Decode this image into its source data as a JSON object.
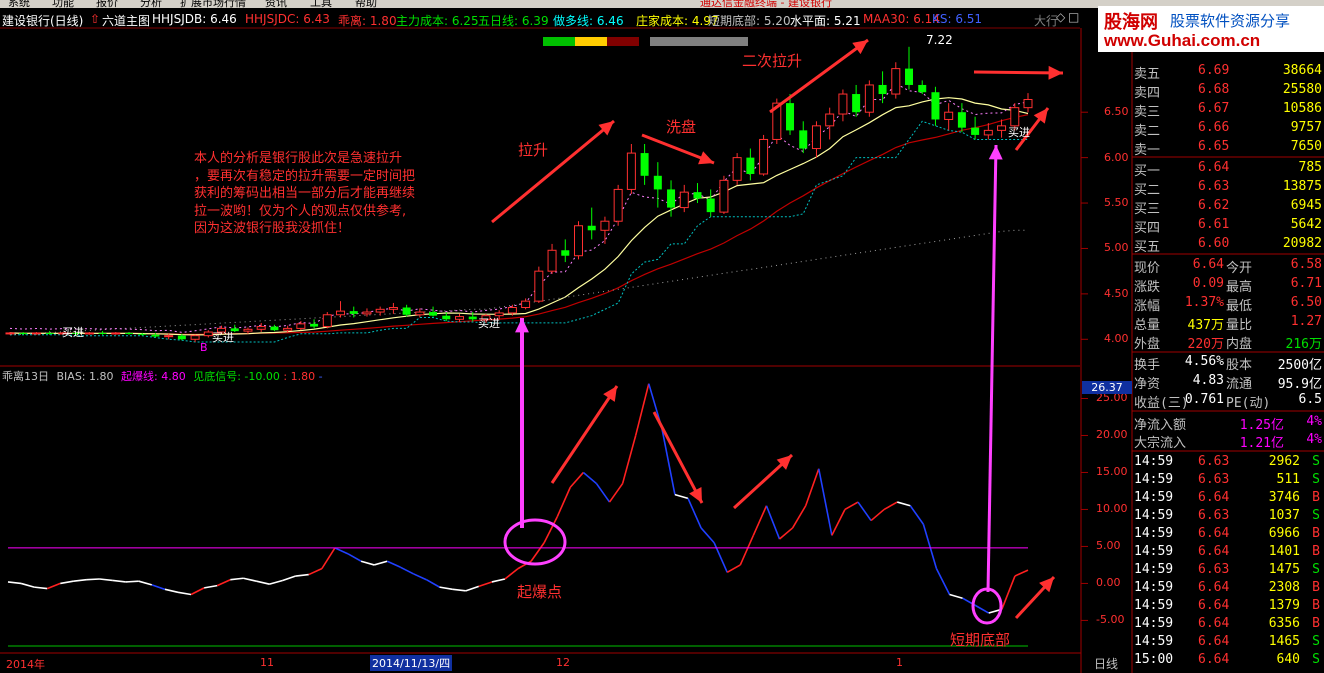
{
  "menu": [
    "系统",
    "功能",
    "报价",
    "分析",
    "扩展市场行情",
    "资讯",
    "工具",
    "帮助"
  ],
  "menu_notice": "通达信金融终端 - 建设银行",
  "header": {
    "stock": "建设银行(日线)",
    "indicator_set": "六道主图",
    "items": [
      {
        "label": "HHJSJDB: 6.46",
        "color": "#ffffff"
      },
      {
        "label": "HHJSJDC: 6.43",
        "color": "#ff3030"
      },
      {
        "label": "乖离: 1.80",
        "color": "#ff3030"
      },
      {
        "label": "主力成本: 6.25",
        "color": "#00e000"
      },
      {
        "label": "五日线: 6.39",
        "color": "#00e000"
      },
      {
        "label": "做多线: 6.46",
        "color": "#00ffff"
      },
      {
        "label": "庄家成本: 4.97",
        "color": "#ffff00"
      },
      {
        "label": "短期底部: 5.20",
        "color": "#c0c0c0"
      },
      {
        "label": "水平面: 5.21",
        "color": "#ffffff"
      },
      {
        "label": "MAA30: 6.14",
        "color": "#ff3030"
      },
      {
        "label": "KS: 6.51",
        "color": "#4060ff"
      }
    ],
    "right_label": "大行",
    "high_label": "7.22"
  },
  "watermark": {
    "brand": "股海网",
    "slogan": "股票软件资源分享",
    "url": "www.Guhai.com.cn"
  },
  "price_axis": [
    "6.50",
    "6.00",
    "5.50",
    "5.00",
    "4.50",
    "4.00"
  ],
  "bias_axis": [
    "25.00",
    "20.00",
    "15.00",
    "10.00",
    "5.00",
    "0.00",
    "-5.00"
  ],
  "bias_current": "26.37",
  "sub_header": {
    "name": "乖离13日",
    "bias": "BIAS: 1.80",
    "burst": "起爆线: 4.80",
    "bottom_signal": "见底信号: -10.00",
    "last": ": 1.80"
  },
  "date_axis": [
    "2014年",
    "11",
    "2014/11/13/四",
    "12",
    "1"
  ],
  "period": "日线",
  "annotations": {
    "analysis": [
      "本人的分析是银行股此次是急速拉升",
      "，要再次有稳定的拉升需要一定时间把",
      "获利的筹码出相当一部分后才能再继续",
      "拉一波哟！仅为个人的观点仅供参考,",
      "因为这波银行股我没抓住！"
    ],
    "pull_up": "拉升",
    "wash": "洗盘",
    "second_pull": "二次拉升",
    "burst_point": "起爆点",
    "short_bottom": "短期底部",
    "buy_marks": [
      "买进",
      "买进",
      "买进",
      "买进"
    ],
    "b_mark": "B"
  },
  "order_book": {
    "asks": [
      {
        "label": "卖五",
        "price": "6.69",
        "vol": "38664"
      },
      {
        "label": "卖四",
        "price": "6.68",
        "vol": "25580"
      },
      {
        "label": "卖三",
        "price": "6.67",
        "vol": "10586"
      },
      {
        "label": "卖二",
        "price": "6.66",
        "vol": "9757"
      },
      {
        "label": "卖一",
        "price": "6.65",
        "vol": "7650"
      }
    ],
    "bids": [
      {
        "label": "买一",
        "price": "6.64",
        "vol": "785"
      },
      {
        "label": "买二",
        "price": "6.63",
        "vol": "13875"
      },
      {
        "label": "买三",
        "price": "6.62",
        "vol": "6945"
      },
      {
        "label": "买四",
        "price": "6.61",
        "vol": "5642"
      },
      {
        "label": "买五",
        "price": "6.60",
        "vol": "20982"
      }
    ]
  },
  "quote": [
    {
      "l1": "现价",
      "v1": "6.64",
      "l2": "今开",
      "v2": "6.58"
    },
    {
      "l1": "涨跌",
      "v1": "0.09",
      "l2": "最高",
      "v2": "6.71"
    },
    {
      "l1": "涨幅",
      "v1": "1.37%",
      "l2": "最低",
      "v2": "6.50"
    },
    {
      "l1": "总量",
      "v1": "437万",
      "l2": "量比",
      "v2": "1.27"
    },
    {
      "l1": "外盘",
      "v1": "220万",
      "l2": "内盘",
      "v2": "216万"
    },
    {
      "l1": "换手",
      "v1": "4.56%",
      "l2": "股本",
      "v2": "2500亿"
    },
    {
      "l1": "净资",
      "v1": "4.83",
      "l2": "流通",
      "v2": "95.9亿"
    },
    {
      "l1": "收益(三)",
      "v1": "0.761",
      "l2": "PE(动)",
      "v2": "6.5"
    }
  ],
  "flows": [
    {
      "label": "净流入额",
      "value": "1.25亿",
      "pct": "4%"
    },
    {
      "label": "大宗流入",
      "value": "1.21亿",
      "pct": "4%"
    }
  ],
  "ticks": [
    {
      "time": "14:59",
      "price": "6.63",
      "vol": "2962",
      "side": "S"
    },
    {
      "time": "14:59",
      "price": "6.63",
      "vol": "511",
      "side": "S"
    },
    {
      "time": "14:59",
      "price": "6.64",
      "vol": "3746",
      "side": "B"
    },
    {
      "time": "14:59",
      "price": "6.63",
      "vol": "1037",
      "side": "S"
    },
    {
      "time": "14:59",
      "price": "6.64",
      "vol": "6966",
      "side": "B"
    },
    {
      "time": "14:59",
      "price": "6.64",
      "vol": "1401",
      "side": "B"
    },
    {
      "time": "14:59",
      "price": "6.63",
      "vol": "1475",
      "side": "S"
    },
    {
      "time": "14:59",
      "price": "6.64",
      "vol": "2308",
      "side": "B"
    },
    {
      "time": "14:59",
      "price": "6.64",
      "vol": "1379",
      "side": "B"
    },
    {
      "time": "14:59",
      "price": "6.64",
      "vol": "6356",
      "side": "B"
    },
    {
      "time": "14:59",
      "price": "6.64",
      "vol": "1465",
      "side": "S"
    },
    {
      "time": "15:00",
      "price": "6.64",
      "vol": "640",
      "side": "S"
    }
  ],
  "chart_data": {
    "type": "candlestick",
    "price_range": [
      3.75,
      7.35
    ],
    "candles": [
      [
        4.07,
        4.08,
        4.05,
        4.07
      ],
      [
        4.07,
        4.08,
        4.05,
        4.06
      ],
      [
        4.06,
        4.08,
        4.05,
        4.07
      ],
      [
        4.07,
        4.09,
        4.05,
        4.06
      ],
      [
        4.06,
        4.08,
        4.05,
        4.07
      ],
      [
        4.07,
        4.08,
        4.04,
        4.06
      ],
      [
        4.06,
        4.08,
        4.05,
        4.07
      ],
      [
        4.07,
        4.09,
        4.05,
        4.06
      ],
      [
        4.06,
        4.08,
        4.05,
        4.07
      ],
      [
        4.07,
        4.08,
        4.05,
        4.06
      ],
      [
        4.06,
        4.07,
        4.04,
        4.05
      ],
      [
        4.05,
        4.07,
        4.02,
        4.03
      ],
      [
        4.03,
        4.06,
        4.0,
        4.04
      ],
      [
        4.04,
        4.06,
        3.99,
        4.0
      ],
      [
        4.0,
        4.05,
        3.97,
        4.04
      ],
      [
        4.04,
        4.1,
        4.02,
        4.08
      ],
      [
        4.08,
        4.15,
        4.06,
        4.12
      ],
      [
        4.12,
        4.16,
        4.08,
        4.09
      ],
      [
        4.09,
        4.13,
        4.06,
        4.11
      ],
      [
        4.11,
        4.18,
        4.08,
        4.14
      ],
      [
        4.14,
        4.16,
        4.09,
        4.1
      ],
      [
        4.1,
        4.15,
        4.07,
        4.12
      ],
      [
        4.12,
        4.2,
        4.1,
        4.17
      ],
      [
        4.17,
        4.22,
        4.12,
        4.14
      ],
      [
        4.14,
        4.3,
        4.12,
        4.27
      ],
      [
        4.27,
        4.42,
        4.24,
        4.31
      ],
      [
        4.31,
        4.36,
        4.24,
        4.28
      ],
      [
        4.28,
        4.34,
        4.25,
        4.3
      ],
      [
        4.3,
        4.36,
        4.26,
        4.33
      ],
      [
        4.33,
        4.4,
        4.28,
        4.35
      ],
      [
        4.35,
        4.38,
        4.25,
        4.27
      ],
      [
        4.27,
        4.34,
        4.24,
        4.3
      ],
      [
        4.3,
        4.36,
        4.25,
        4.26
      ],
      [
        4.26,
        4.3,
        4.2,
        4.22
      ],
      [
        4.22,
        4.28,
        4.19,
        4.25
      ],
      [
        4.25,
        4.3,
        4.2,
        4.22
      ],
      [
        4.22,
        4.28,
        4.18,
        4.26
      ],
      [
        4.26,
        4.32,
        4.22,
        4.29
      ],
      [
        4.29,
        4.38,
        4.26,
        4.35
      ],
      [
        4.35,
        4.45,
        4.33,
        4.42
      ],
      [
        4.42,
        4.8,
        4.4,
        4.75
      ],
      [
        4.75,
        5.05,
        4.72,
        4.98
      ],
      [
        4.98,
        5.1,
        4.85,
        4.92
      ],
      [
        4.92,
        5.3,
        4.88,
        5.25
      ],
      [
        5.25,
        5.45,
        5.1,
        5.2
      ],
      [
        5.2,
        5.35,
        5.05,
        5.3
      ],
      [
        5.3,
        5.7,
        5.25,
        5.65
      ],
      [
        5.65,
        6.15,
        5.6,
        6.05
      ],
      [
        6.05,
        6.15,
        5.7,
        5.8
      ],
      [
        5.8,
        5.95,
        5.45,
        5.65
      ],
      [
        5.65,
        5.75,
        5.35,
        5.45
      ],
      [
        5.45,
        5.7,
        5.4,
        5.62
      ],
      [
        5.62,
        5.72,
        5.5,
        5.55
      ],
      [
        5.55,
        5.65,
        5.35,
        5.4
      ],
      [
        5.4,
        5.8,
        5.38,
        5.75
      ],
      [
        5.75,
        6.05,
        5.7,
        6.0
      ],
      [
        6.0,
        6.1,
        5.75,
        5.82
      ],
      [
        5.82,
        6.25,
        5.8,
        6.2
      ],
      [
        6.2,
        6.65,
        6.15,
        6.6
      ],
      [
        6.6,
        6.7,
        6.25,
        6.3
      ],
      [
        6.3,
        6.4,
        6.05,
        6.1
      ],
      [
        6.1,
        6.4,
        6.0,
        6.35
      ],
      [
        6.35,
        6.55,
        6.2,
        6.48
      ],
      [
        6.48,
        6.75,
        6.4,
        6.7
      ],
      [
        6.7,
        6.8,
        6.45,
        6.5
      ],
      [
        6.5,
        6.85,
        6.45,
        6.8
      ],
      [
        6.8,
        6.95,
        6.6,
        6.7
      ],
      [
        6.7,
        7.05,
        6.65,
        6.98
      ],
      [
        6.98,
        7.22,
        6.75,
        6.8
      ],
      [
        6.8,
        6.85,
        6.7,
        6.72
      ],
      [
        6.72,
        6.78,
        6.35,
        6.42
      ],
      [
        6.42,
        6.6,
        6.3,
        6.5
      ],
      [
        6.5,
        6.6,
        6.28,
        6.33
      ],
      [
        6.33,
        6.45,
        6.2,
        6.25
      ],
      [
        6.25,
        6.38,
        6.2,
        6.3
      ],
      [
        6.3,
        6.42,
        6.22,
        6.35
      ],
      [
        6.35,
        6.6,
        6.3,
        6.55
      ],
      [
        6.55,
        6.71,
        6.5,
        6.64
      ]
    ],
    "bias": [
      0.2,
      0.0,
      -0.5,
      -0.7,
      0.0,
      0.3,
      0.5,
      0.6,
      0.4,
      0.2,
      0.3,
      -0.2,
      -0.8,
      -1.2,
      -1.5,
      -0.6,
      -0.3,
      0.5,
      0.7,
      0.3,
      -0.1,
      0.4,
      1.0,
      1.2,
      2.0,
      4.8,
      4.0,
      3.0,
      2.5,
      3.0,
      2.2,
      1.3,
      0.5,
      -0.5,
      -0.8,
      -1.0,
      -0.4,
      0.2,
      0.6,
      2.0,
      3.0,
      5.5,
      9.0,
      13.0,
      15.0,
      13.5,
      11.0,
      13.5,
      20.0,
      27.0,
      21.0,
      12.0,
      11.5,
      7.5,
      5.5,
      1.5,
      2.5,
      6.5,
      10.5,
      6.0,
      7.5,
      10.5,
      15.5,
      6.5,
      10.0,
      11.0,
      8.5,
      10.0,
      11.0,
      10.5,
      8.0,
      2.0,
      -1.5,
      -2.0,
      -3.0,
      -4.0,
      -3.5,
      1.0,
      1.8
    ],
    "bias_range": [
      -9.0,
      27.5
    ],
    "burst_line": 4.8
  }
}
